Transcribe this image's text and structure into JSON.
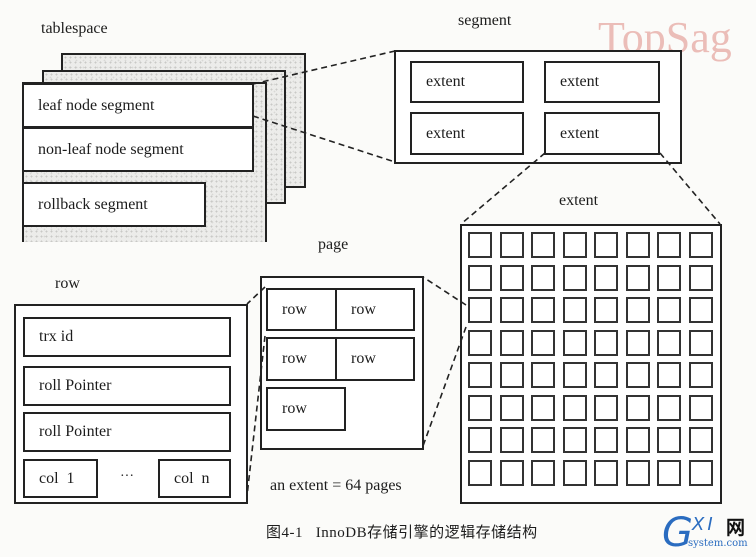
{
  "tablespace": {
    "title": "tablespace",
    "segments": [
      "leaf node segment",
      "non-leaf node segment",
      "rollback segment"
    ]
  },
  "segment": {
    "title": "segment",
    "extents": [
      "extent",
      "extent",
      "extent",
      "extent"
    ]
  },
  "extent": {
    "title": "extent",
    "grid_rows": 8,
    "grid_cols": 8
  },
  "page": {
    "title": "page",
    "rows": [
      "row",
      "row",
      "row",
      "row",
      "row"
    ],
    "note": "an extent = 64 pages"
  },
  "row": {
    "title": "row",
    "fields": [
      "trx id",
      "roll Pointer",
      "roll Pointer"
    ],
    "columns": [
      "col  1",
      "col  n"
    ],
    "ellipsis": "···"
  },
  "caption": "图4-1   InnoDB存储引擎的逻辑存储结构",
  "watermark": "TopSag",
  "logo": {
    "g": "G",
    "xi": "XI",
    "wang": "网",
    "domain": "system.com"
  }
}
